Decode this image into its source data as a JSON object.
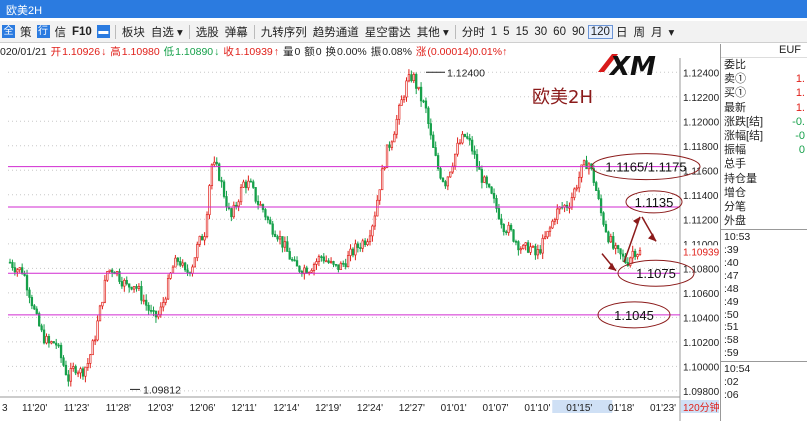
{
  "window": {
    "title": "欧美2H"
  },
  "toolbar": {
    "icons": [
      "全",
      "策",
      "行",
      "信",
      "F10"
    ],
    "items": [
      "板块",
      "自选 ▾",
      "选股",
      "弹幕",
      "九转序列",
      "趋势通道",
      "星空雷达",
      "其他 ▾",
      "分时",
      "1",
      "5",
      "15",
      "30",
      "60",
      "90",
      "120",
      "日",
      "周",
      "月",
      "▾"
    ],
    "active": "120"
  },
  "info": {
    "date": "020/01/21",
    "open_label": "开",
    "open": "1.10926",
    "open_arrow": "↓",
    "high_label": "高",
    "high": "1.10980",
    "low_label": "低",
    "low": "1.10890",
    "low_arrow": "↓",
    "close_label": "收",
    "close": "1.10939",
    "close_arrow": "↑",
    "vol_label": "量",
    "vol": "0",
    "amt_label": "额",
    "amt": "0",
    "turnover_label": "换",
    "turnover": "0.00%",
    "amp_label": "振",
    "amp": "0.08%",
    "chg_label": "涨",
    "chg": "(0.00014)0.01%↑"
  },
  "brand": {
    "logo_text": "XM",
    "pair_label": "欧美2H"
  },
  "side_panel": {
    "header": "EUF",
    "rows": [
      {
        "label": "委比",
        "value": ""
      },
      {
        "label": "卖①",
        "value": "1."
      },
      {
        "label": "买①",
        "value": "1."
      },
      {
        "label": "最新",
        "value": "1."
      },
      {
        "label": "涨跌[结]",
        "value": "-0."
      },
      {
        "label": "涨幅[结]",
        "value": "-0"
      },
      {
        "label": "振幅",
        "value": "0"
      },
      {
        "label": "总手",
        "value": ""
      },
      {
        "label": "持仓量",
        "value": ""
      },
      {
        "label": "增仓",
        "value": ""
      },
      {
        "label": "分笔",
        "value": ""
      },
      {
        "label": "外盘",
        "value": ""
      }
    ],
    "ticks_a": [
      "10:53",
      ":39",
      ":40",
      ":47",
      ":48",
      ":49",
      ":50",
      ":51",
      ":58",
      ":59"
    ],
    "ticks_b": [
      "10:54",
      ":02",
      ":06"
    ]
  },
  "chart_data": {
    "type": "candlestick",
    "symbol": "EURUSD",
    "timeframe": "120分钟",
    "ylim": [
      1.0975,
      1.125
    ],
    "yticks": [
      "1.12400",
      "1.12200",
      "1.12000",
      "1.11800",
      "1.11600",
      "1.11400",
      "1.11200",
      "1.11000",
      "1.10800",
      "1.10600",
      "1.10400",
      "1.10200",
      "1.10000",
      "1.09800"
    ],
    "xticks": [
      "11'20'",
      "11'23'",
      "11'28'",
      "12'03'",
      "12'06'",
      "12'11'",
      "12'14'",
      "12'19'",
      "12'24'",
      "12'27'",
      "01'01'",
      "01'07'",
      "01'10'",
      "01'15'",
      "01'18'",
      "01'23'"
    ],
    "xtick_first": "3",
    "last_price": "1.10939",
    "high_mark": {
      "label": "1.12400",
      "value": 1.124
    },
    "low_mark": {
      "label": "1.09812",
      "value": 1.09812
    },
    "path": [
      1.1085,
      1.108,
      1.1078,
      1.106,
      1.104,
      1.1025,
      1.1018,
      1.102,
      1.1005,
      1.099,
      1.1,
      1.0995,
      1.1003,
      1.1022,
      1.105,
      1.1078,
      1.108,
      1.1072,
      1.1065,
      1.1068,
      1.106,
      1.105,
      1.104,
      1.1042,
      1.106,
      1.108,
      1.1088,
      1.1075,
      1.1082,
      1.11,
      1.111,
      1.1165,
      1.116,
      1.114,
      1.112,
      1.1135,
      1.115,
      1.1148,
      1.1135,
      1.1128,
      1.1115,
      1.111,
      1.11,
      1.109,
      1.108,
      1.108,
      1.108,
      1.1085,
      1.109,
      1.1085,
      1.108,
      1.1082,
      1.1088,
      1.1095,
      1.11,
      1.1105,
      1.112,
      1.115,
      1.1175,
      1.119,
      1.121,
      1.123,
      1.1238,
      1.1222,
      1.121,
      1.118,
      1.116,
      1.115,
      1.1165,
      1.118,
      1.1188,
      1.118,
      1.1162,
      1.115,
      1.114,
      1.1128,
      1.1115,
      1.111,
      1.1102,
      1.1095,
      1.1098,
      1.109,
      1.11,
      1.111,
      1.1125,
      1.113,
      1.1132,
      1.1145,
      1.116,
      1.1168,
      1.115,
      1.1125,
      1.1108,
      1.1095,
      1.109,
      1.1085,
      1.1095,
      1.1093
    ],
    "hlines": [
      {
        "label": "1.1165/1.1175",
        "value": 1.1163
      },
      {
        "label": "1.1135",
        "value": 1.113
      },
      {
        "label": "1.1075",
        "value": 1.1076
      },
      {
        "label": "1.1045",
        "value": 1.1042
      }
    ],
    "colors": {
      "up": "#e0201a",
      "down": "#16a04a",
      "hline": "#d12ad1",
      "annotation": "#8b1a1a",
      "grid": "#c8c8c8"
    }
  }
}
